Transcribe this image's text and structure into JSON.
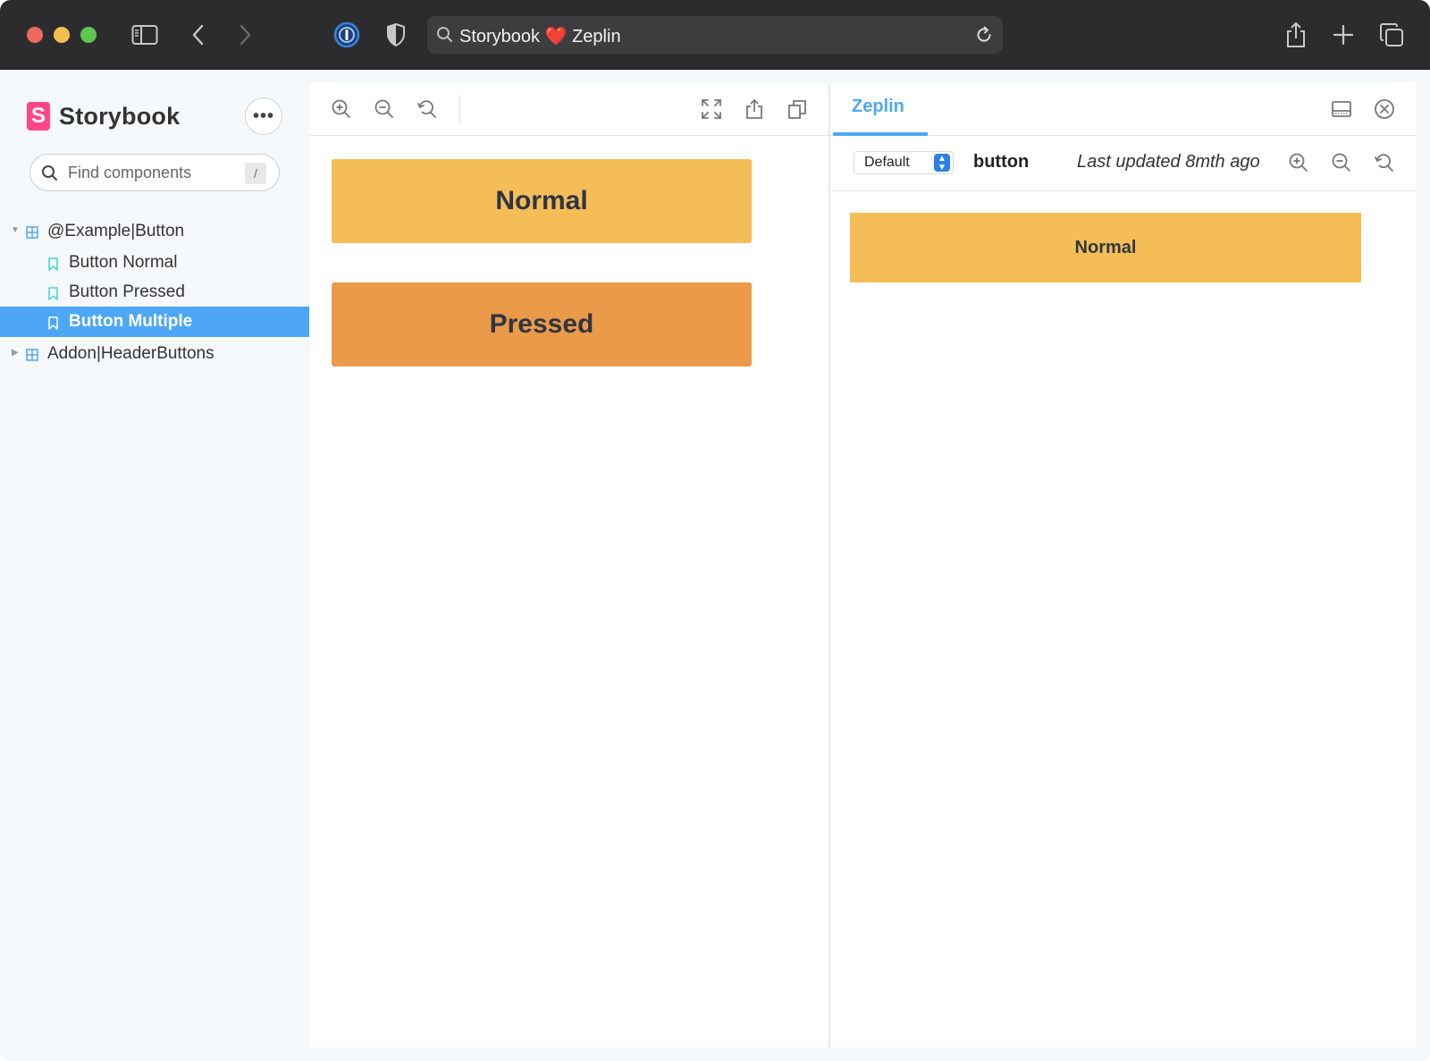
{
  "browser": {
    "url_text_before": "Storybook",
    "url_heart": "❤️",
    "url_text_after": "Zeplin",
    "icons": [
      "sidebar-toggle-icon",
      "back-icon",
      "forward-icon",
      "password-manager-icon",
      "shield-icon",
      "search-icon",
      "reload-icon",
      "share-icon",
      "new-tab-icon",
      "tabs-overview-icon"
    ]
  },
  "sidebar": {
    "brand": "Storybook",
    "brand_logo": "S",
    "more_label": "•••",
    "search_placeholder": "Find components",
    "search_shortcut": "/",
    "tree": [
      {
        "label": "@Example|Button",
        "type": "component",
        "expanded": true
      },
      {
        "label": "Button Normal",
        "type": "story"
      },
      {
        "label": "Button Pressed",
        "type": "story"
      },
      {
        "label": "Button Multiple",
        "type": "story",
        "selected": true
      },
      {
        "label": "Addon|HeaderButtons",
        "type": "component",
        "expanded": false
      }
    ]
  },
  "canvas": {
    "buttons": [
      {
        "label": "Normal",
        "color": "#f5bd55"
      },
      {
        "label": "Pressed",
        "color": "#ea9a48"
      }
    ]
  },
  "addon": {
    "tab": "Zeplin",
    "select_value": "Default",
    "component_name": "button",
    "last_updated": "Last updated 8mth ago",
    "preview_button": "Normal"
  },
  "colors": {
    "accent": "#4ea7f6",
    "storybook_pink": "#ff4785",
    "normal_button": "#f5bd55",
    "pressed_button": "#ea9a48"
  }
}
